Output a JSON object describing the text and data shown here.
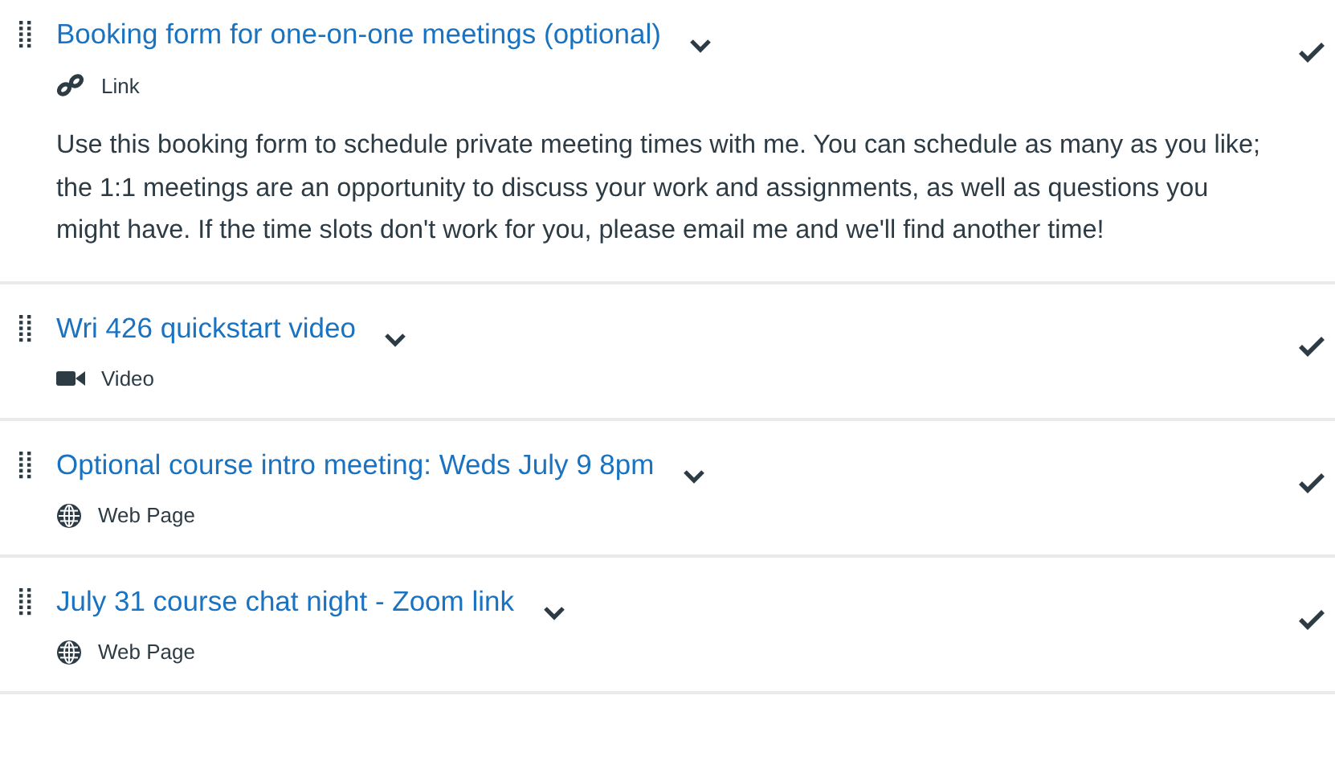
{
  "items": [
    {
      "title": "Booking form for one-on-one meetings (optional)",
      "kind": "link",
      "type_label": "Link",
      "completed": true,
      "description": "Use this booking form to schedule private meeting times with me. You can schedule as many as you like; the 1:1 meetings are an opportunity to discuss your work and assignments, as well as questions you might have. If the time slots don't work for you, please email me and we'll find another time!"
    },
    {
      "title": "Wri 426 quickstart video",
      "kind": "video",
      "type_label": "Video",
      "completed": true
    },
    {
      "title": "Optional course intro meeting: Weds July 9 8pm",
      "kind": "page",
      "type_label": "Web Page",
      "completed": true
    },
    {
      "title": "July 31 course chat night - Zoom link",
      "kind": "page",
      "type_label": "Web Page",
      "completed": true
    }
  ]
}
